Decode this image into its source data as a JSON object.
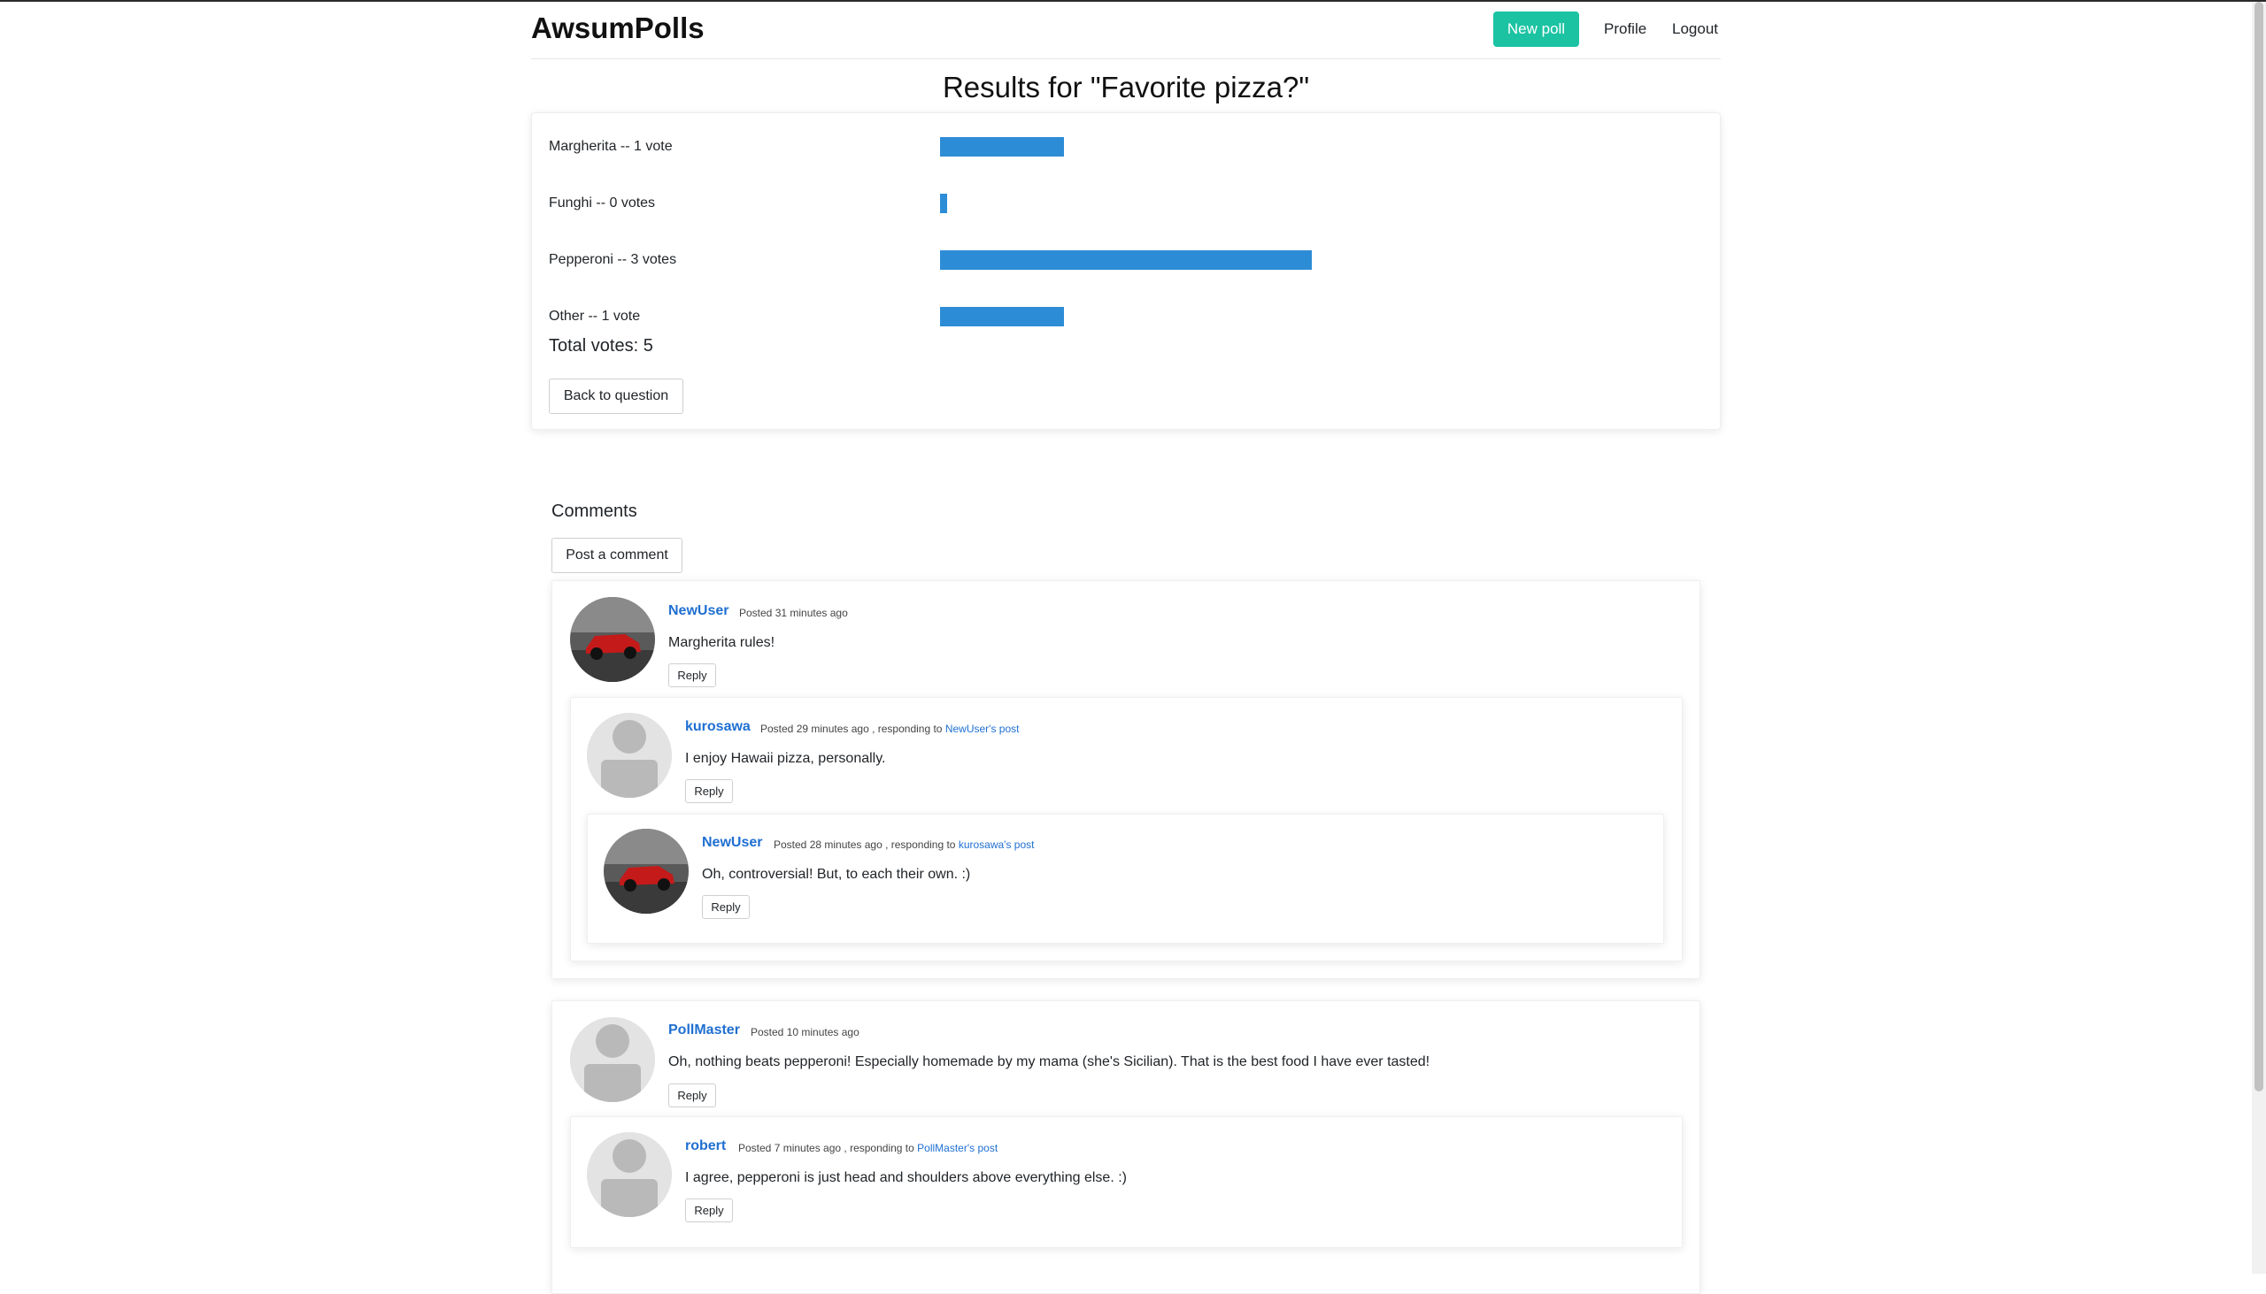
{
  "brand": "AwsumPolls",
  "nav": {
    "new_poll": "New poll",
    "profile": "Profile",
    "logout": "Logout"
  },
  "page_title": "Results for \"Favorite pizza?\"",
  "results": {
    "options": [
      {
        "label": "Margherita -- 1 vote",
        "votes": 1,
        "fraction": 0.2
      },
      {
        "label": "Funghi -- 0 votes",
        "votes": 0,
        "fraction": 0.0
      },
      {
        "label": "Pepperoni -- 3 votes",
        "votes": 3,
        "fraction": 0.6
      },
      {
        "label": "Other -- 1 vote",
        "votes": 1,
        "fraction": 0.2
      }
    ],
    "bar_color": "#2d8cd6",
    "total": "Total votes: 5",
    "back_button": "Back to question"
  },
  "comments": {
    "title": "Comments",
    "post_button": "Post a comment",
    "reply_label": "Reply",
    "items": [
      {
        "author": "NewUser",
        "posted": "Posted 31 minutes ago",
        "responding": "",
        "target": "",
        "text": "Margherita rules!",
        "avatar": "car-photo"
      },
      {
        "author": "kurosawa",
        "posted": "Posted 29 minutes ago",
        "responding": ", responding to",
        "target": "NewUser's post",
        "text": "I enjoy Hawaii pizza, personally.",
        "avatar": "default-user"
      },
      {
        "author": "NewUser",
        "posted": "Posted 28 minutes ago",
        "responding": ", responding to",
        "target": "kurosawa's post",
        "text": "Oh, controversial! But, to each their own. :)",
        "avatar": "car-photo"
      },
      {
        "author": "PollMaster",
        "posted": "Posted 10 minutes ago",
        "responding": "",
        "target": "",
        "text": "Oh, nothing beats pepperoni! Especially homemade by my mama (she's Sicilian). That is the best food I have ever tasted!",
        "avatar": "default-user"
      },
      {
        "author": "robert",
        "posted": "Posted 7 minutes ago",
        "responding": ", responding to",
        "target": "PollMaster's post",
        "text": "I agree, pepperoni is just head and shoulders above everything else. :)",
        "avatar": "default-user"
      }
    ]
  },
  "colors": {
    "accent": "#1cc3a3",
    "link": "#1f6fd1"
  }
}
